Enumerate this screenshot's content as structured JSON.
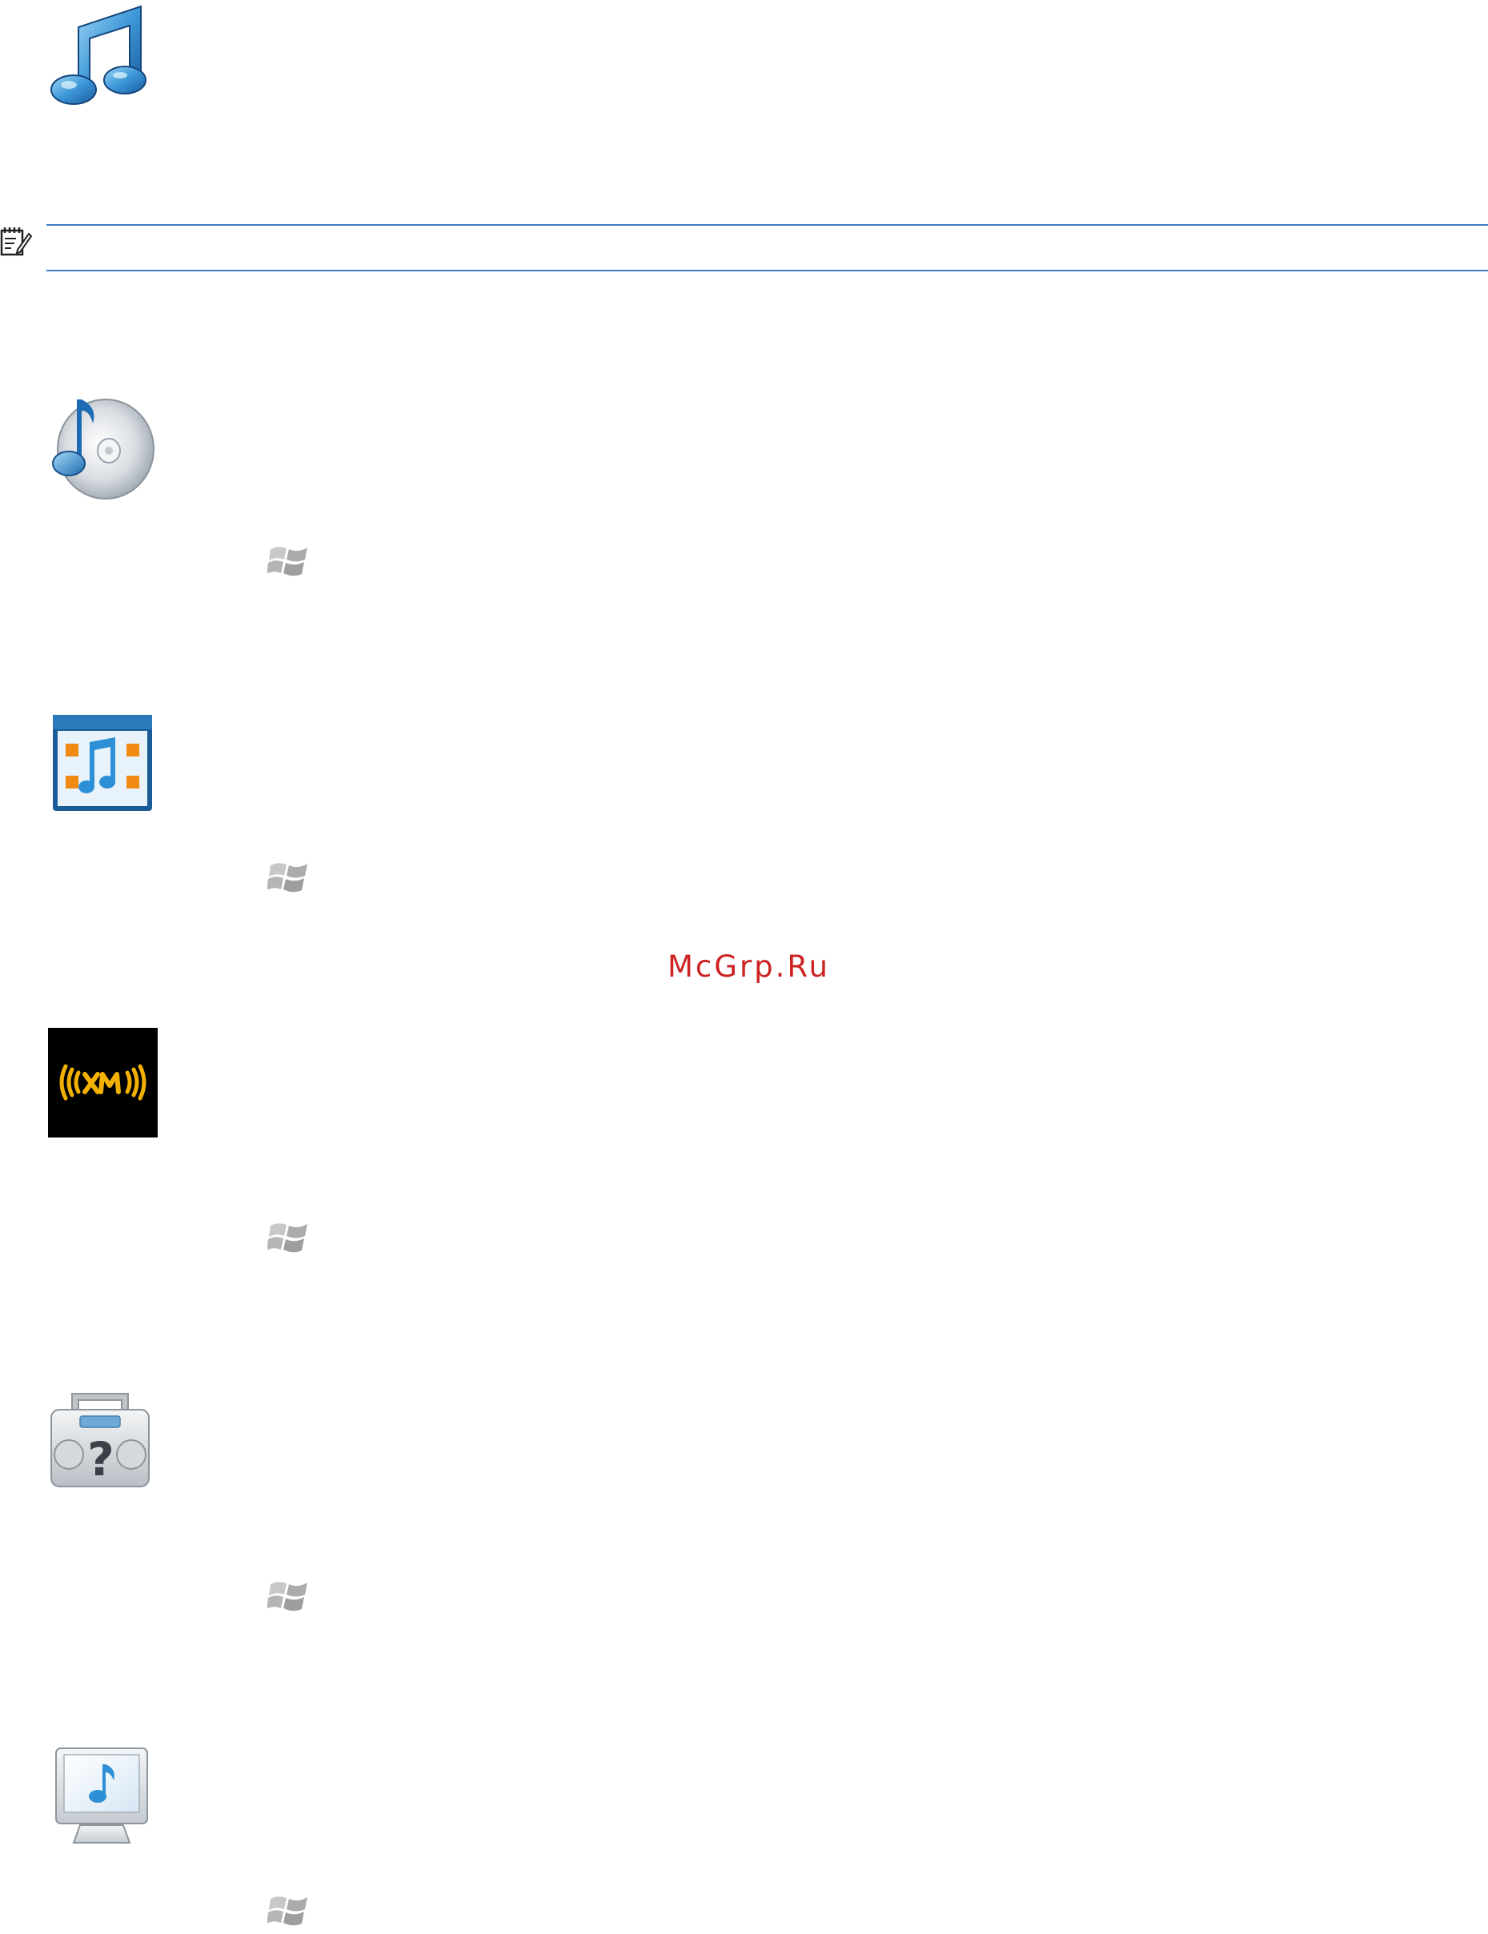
{
  "document": {
    "watermark": "McGrp.Ru"
  },
  "icons": [
    "music-notes-icon",
    "note-icon",
    "music-cd-icon",
    "windows-logo-icon",
    "music-library-icon",
    "windows-logo-icon",
    "xm-radio-icon",
    "windows-logo-icon",
    "boombox-help-icon",
    "windows-logo-icon",
    "music-monitor-icon",
    "windows-logo-icon"
  ],
  "colors": {
    "accent_blue": "#3f7fc4",
    "watermark_red": "#cc2222",
    "xm_yellow": "#f2b100"
  }
}
